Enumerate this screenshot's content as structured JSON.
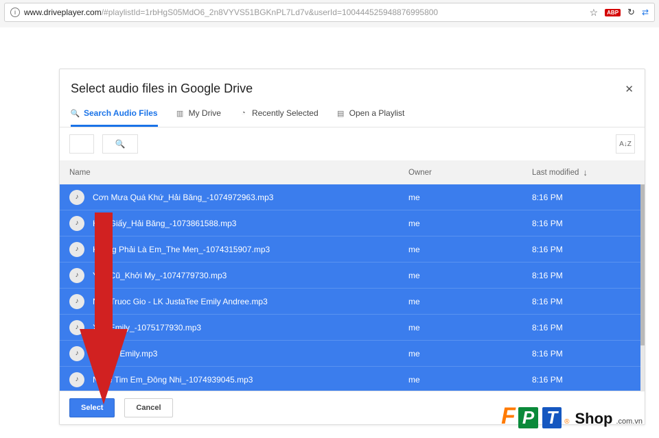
{
  "address_bar": {
    "host": "www.driveplayer.com",
    "path": "/#playlistId=1rbHgS05MdO6_2n8VYVS51BGKnPL7Ld7v&userId=100444525948876995800"
  },
  "dialog": {
    "title": "Select audio files in Google Drive",
    "tabs": [
      {
        "label": "Search Audio Files",
        "icon": "search-icon"
      },
      {
        "label": "My Drive",
        "icon": "folder-icon"
      },
      {
        "label": "Recently Selected",
        "icon": "clock-icon"
      },
      {
        "label": "Open a Playlist",
        "icon": "file-icon"
      }
    ],
    "active_tab_index": 0,
    "columns": {
      "name": "Name",
      "owner": "Owner",
      "modified": "Last modified"
    },
    "files": [
      {
        "name": "Cơn Mưa Quá Khứ_Hải Băng_-1074972963.mp3",
        "owner": "me",
        "modified": "8:16 PM"
      },
      {
        "name": "Hạc Giấy_Hải Băng_-1073861588.mp3",
        "owner": "me",
        "modified": "8:16 PM"
      },
      {
        "name": "Không Phải Là Em_The Men_-1074315907.mp3",
        "owner": "me",
        "modified": "8:16 PM"
      },
      {
        "name": "Yêu Cũ_Khởi My_-1074779730.mp3",
        "owner": "me",
        "modified": "8:16 PM"
      },
      {
        "name": "Nen Truoc Gio - LK JustaTee Emily Andree.mp3",
        "owner": "me",
        "modified": "8:16 PM"
      },
      {
        "name": "Xa _Emily_-1075177930.mp3",
        "owner": "me",
        "modified": "8:16 PM"
      },
      {
        "name": "Nhau - Emily.mp3",
        "owner": "me",
        "modified": "8:16 PM"
      },
      {
        "name": "Nghe Tim Em_Đông Nhi_-1074939045.mp3",
        "owner": "me",
        "modified": "8:16 PM"
      }
    ],
    "buttons": {
      "select": "Select",
      "cancel": "Cancel"
    }
  },
  "watermark": {
    "brand_f": "F",
    "brand_p": "P",
    "brand_t": "T",
    "shop": "Shop",
    "domain": ".com.vn"
  }
}
